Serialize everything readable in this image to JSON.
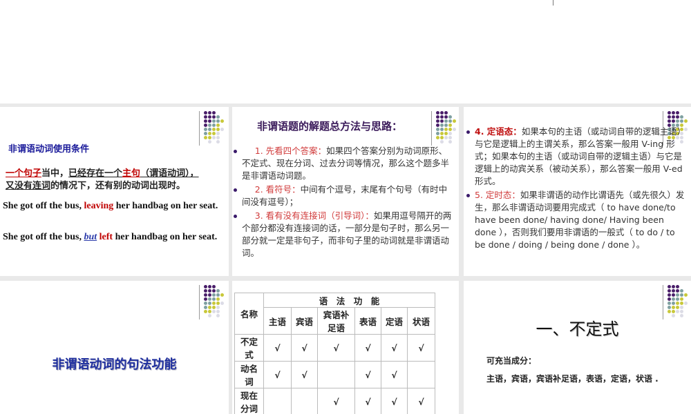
{
  "slide1": {
    "heading": "非谓语动词使用条件",
    "cond": {
      "a": "一个句子",
      "b": "当中，",
      "c": "已经存在一个",
      "d": "主句",
      "e": "（谓语动词），",
      "f": "又没有连词",
      "g": "的情况下，还有别的动词出现时。"
    },
    "ex1": {
      "a": "She got off the bus, ",
      "b": "leaving",
      "c": " her handbag on her seat."
    },
    "ex2": {
      "a": "She got off the bus, ",
      "b": "but",
      "c": "left",
      "d": " her handbag on her seat."
    }
  },
  "slide2": {
    "title": "非谓语题的解题总方法与思路：",
    "items": [
      {
        "label": "1. 先看四个答案：",
        "text": "如果四个答案分别为动词原形、不定式、现在分词、过去分词等情况，那么这个题多半是非谓语动词题。"
      },
      {
        "label": "2. 看符号：",
        "text": "中间有个逗号，末尾有个句号（有时中间没有逗号）；"
      },
      {
        "label": "3. 看有没有连接词（引导词）：",
        "text": "如果用逗号隔开的两个部分都没有连接词的话，一部分是句子时，那么另一部分就一定是非句子，而非句子里的动词就是非谓语动词。"
      }
    ]
  },
  "slide3": {
    "items": [
      {
        "label": "4. 定语态：",
        "text": "如果本句的主语（或动词自带的逻辑主语）与它是逻辑上的主谓关系，那么答案一般用 V-ing 形式；如果本句的主语（或动词自带的逻辑主语）与它是逻辑上的动宾关系（被动关系），那么答案一般用 V-ed 形式。"
      },
      {
        "label": "5. 定时态：",
        "text": "如果非谓语的动作比谓语先（或先很久）发生，那么非谓语动词要用完成式（ to have done/to have been done/ having done/ Having been done ），否则我们要用非谓语的一般式（ to do / to be done / doing / being done / done ）。"
      }
    ]
  },
  "slide4": {
    "title": "非谓语动词的句法功能"
  },
  "slide5": {
    "name_header": "名称",
    "group_header": "语　法　功　能",
    "columns": [
      "主语",
      "宾语",
      "宾语补足语",
      "表语",
      "定语",
      "状语"
    ],
    "rows": [
      {
        "name": "不定式",
        "marks": [
          "√",
          "√",
          "√",
          "√",
          "√",
          "√"
        ]
      },
      {
        "name": "动名词",
        "marks": [
          "√",
          "√",
          "",
          "√",
          "√",
          ""
        ]
      },
      {
        "name": "现在分词",
        "marks": [
          "",
          "",
          "√",
          "√",
          "√",
          "√"
        ]
      }
    ]
  },
  "slide6": {
    "title": "一、不定式",
    "sub": "可充当成分：",
    "list": "主语，宾语，宾语补足语，表语，定语，状语 ."
  }
}
